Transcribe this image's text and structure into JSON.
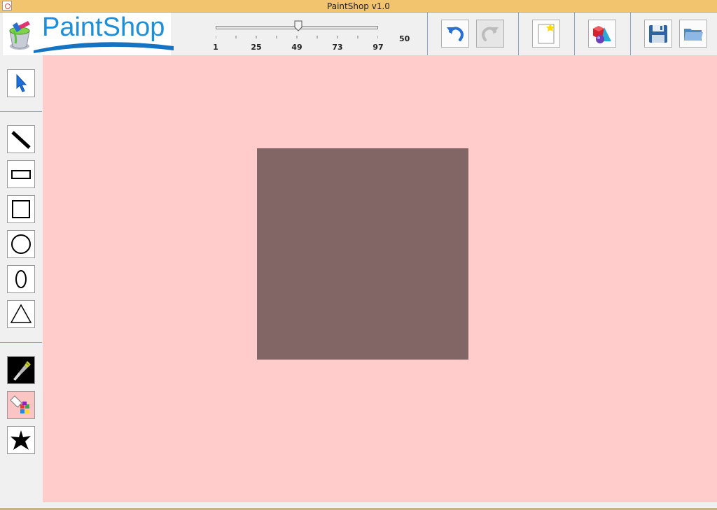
{
  "window": {
    "title": "PaintShop v1.0"
  },
  "logo": {
    "text": "PaintShop"
  },
  "stroke_slider": {
    "min": 1,
    "max": 97,
    "value": 50,
    "value_label": "50",
    "tick_labels": [
      "1",
      "25",
      "49",
      "73",
      "97"
    ]
  },
  "toolbar": {
    "buttons": [
      {
        "name": "undo",
        "icon": "undo-arrow-icon",
        "enabled": true
      },
      {
        "name": "redo",
        "icon": "redo-arrow-icon",
        "enabled": false
      },
      {
        "name": "new",
        "icon": "new-document-icon",
        "enabled": true
      },
      {
        "name": "shapes",
        "icon": "3d-shapes-icon",
        "enabled": true
      },
      {
        "name": "save",
        "icon": "floppy-disk-icon",
        "enabled": true
      },
      {
        "name": "open",
        "icon": "folder-icon",
        "enabled": true
      }
    ]
  },
  "tools": [
    {
      "name": "select",
      "icon": "cursor-arrow-icon"
    },
    {
      "name": "line",
      "icon": "line-icon"
    },
    {
      "name": "rectangle",
      "icon": "rectangle-icon"
    },
    {
      "name": "square",
      "icon": "square-icon"
    },
    {
      "name": "circle",
      "icon": "circle-icon"
    },
    {
      "name": "ellipse",
      "icon": "ellipse-icon"
    },
    {
      "name": "triangle",
      "icon": "triangle-icon"
    },
    {
      "name": "brush",
      "icon": "brush-icon"
    },
    {
      "name": "fill",
      "icon": "paint-bucket-palette-icon"
    },
    {
      "name": "star",
      "icon": "star-icon"
    }
  ],
  "canvas": {
    "background_color": "#ffcbcb",
    "shapes": [
      {
        "type": "square",
        "fill_color": "#826565"
      }
    ]
  },
  "colors": {
    "titlebar": "#f2c46e",
    "accent": "#1d8fd8",
    "separator": "#8aa6c7"
  }
}
